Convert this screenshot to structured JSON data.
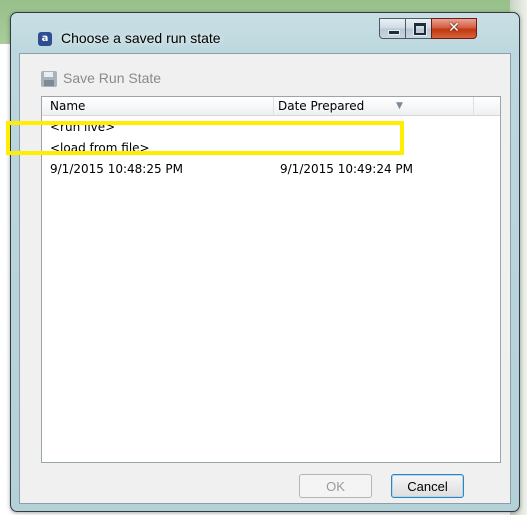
{
  "window": {
    "title": "Choose a saved run state",
    "app_icon_letter": "a"
  },
  "toolbar": {
    "save_label": "Save Run State"
  },
  "list": {
    "columns": [
      "Name",
      "Date Prepared"
    ],
    "sort_indicator": "▼",
    "rows": [
      {
        "name": "<run live>",
        "date": ""
      },
      {
        "name": "<load from file>",
        "date": ""
      },
      {
        "name": "9/1/2015 10:48:25 PM",
        "date": "9/1/2015 10:49:24 PM"
      }
    ]
  },
  "buttons": {
    "ok": "OK",
    "cancel": "Cancel"
  },
  "caption": {
    "close_glyph": "✕"
  },
  "colors": {
    "highlight": "#ffee00"
  }
}
